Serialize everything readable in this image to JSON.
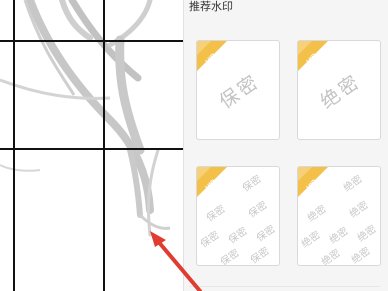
{
  "panel": {
    "title": "推荐水印",
    "cards": [
      {
        "id": "card-1",
        "badge": "VIP",
        "text": "保密",
        "style": "single"
      },
      {
        "id": "card-2",
        "badge": "VIP",
        "text": "绝密",
        "style": "single"
      },
      {
        "id": "card-3",
        "badge": "VIP",
        "text": "保密",
        "style": "tiled"
      },
      {
        "id": "card-4",
        "badge": "VIP",
        "text": "绝密",
        "style": "tiled"
      }
    ]
  },
  "colors": {
    "vip_badge": "#f3c04a",
    "watermark_text": "#c3c3c3",
    "panel_bg": "#f5f5f5",
    "arrow": "#e03c31",
    "doc_watermark_stroke": "#bdbdbd"
  },
  "icons": {
    "pointer": "red-arrow-pointer-icon"
  }
}
